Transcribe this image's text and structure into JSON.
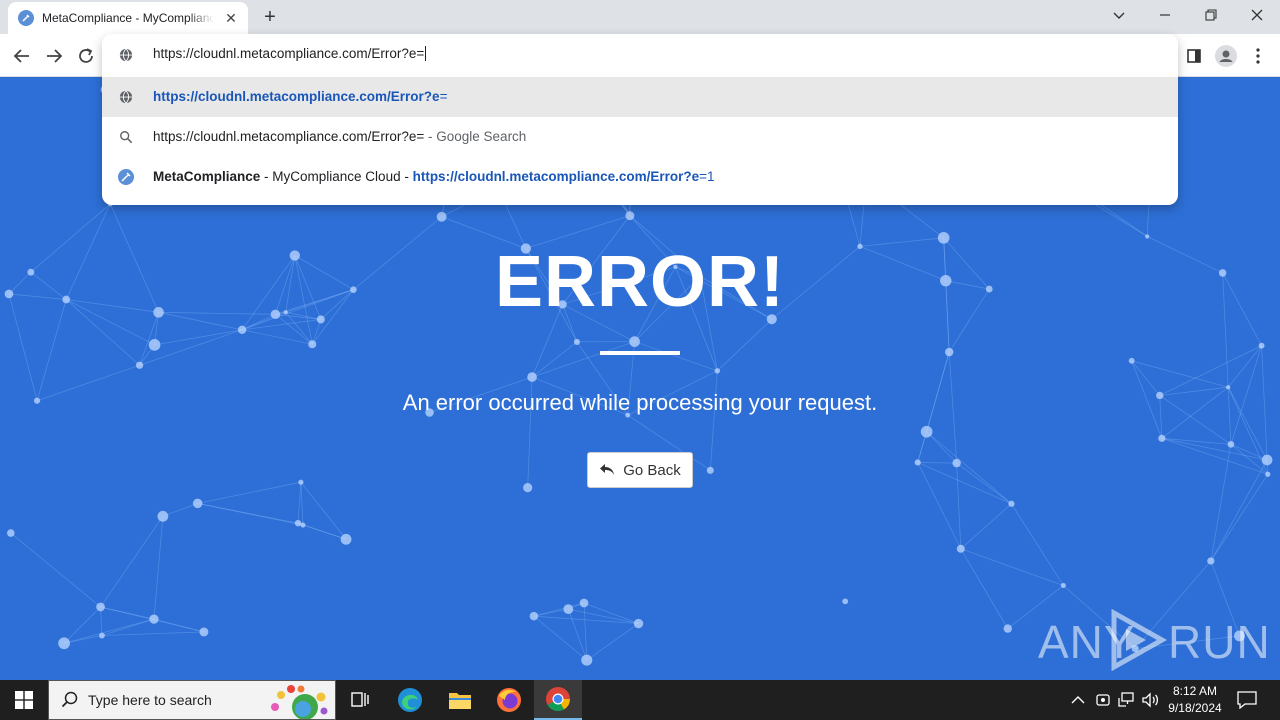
{
  "browser": {
    "tab": {
      "title": "MetaCompliance - MyCompliance Cloud",
      "close_glyph": "✕",
      "favicon": "metacompliance-favicon-icon"
    },
    "new_tab_glyph": "+",
    "window_controls": [
      "chevron-down-icon",
      "minimize-icon",
      "restore-icon",
      "close-icon"
    ],
    "nav": [
      "back-icon",
      "forward-icon",
      "reload-icon"
    ],
    "omnibox": {
      "input_value": "https://cloudnl.metacompliance.com/Error?e=",
      "suggestions": [
        {
          "icon": "globe-icon",
          "url_bold": "https://cloudnl.metacompliance.com/Error?e",
          "url_rest": "="
        },
        {
          "icon": "search-icon",
          "query": "https://cloudnl.metacompliance.com/Error?e=",
          "suffix": " - Google Search"
        },
        {
          "icon": "metacompliance-favicon-icon",
          "site_bold": "MetaCompliance",
          "site_rest": " - MyCompliance Cloud - ",
          "url_bold": "https://cloudnl.metacompliance.com/Error?e",
          "url_rest": "=1"
        }
      ]
    }
  },
  "page": {
    "title": "ERROR!",
    "message": "An error occurred while processing your request.",
    "go_back_label": "Go Back",
    "watermark": {
      "left": "ANY",
      "right": "RUN"
    },
    "colors": {
      "background": "#2d6fd6",
      "text": "#ffffff"
    }
  },
  "taskbar": {
    "search_placeholder": "Type here to search",
    "apps": [
      "task-view-icon",
      "edge-icon",
      "file-explorer-icon",
      "firefox-icon",
      "chrome-icon"
    ],
    "tray": [
      "chevron-up-icon",
      "network-security-icon",
      "network-icon",
      "volume-icon"
    ],
    "time": "8:12 AM",
    "date": "9/18/2024"
  }
}
